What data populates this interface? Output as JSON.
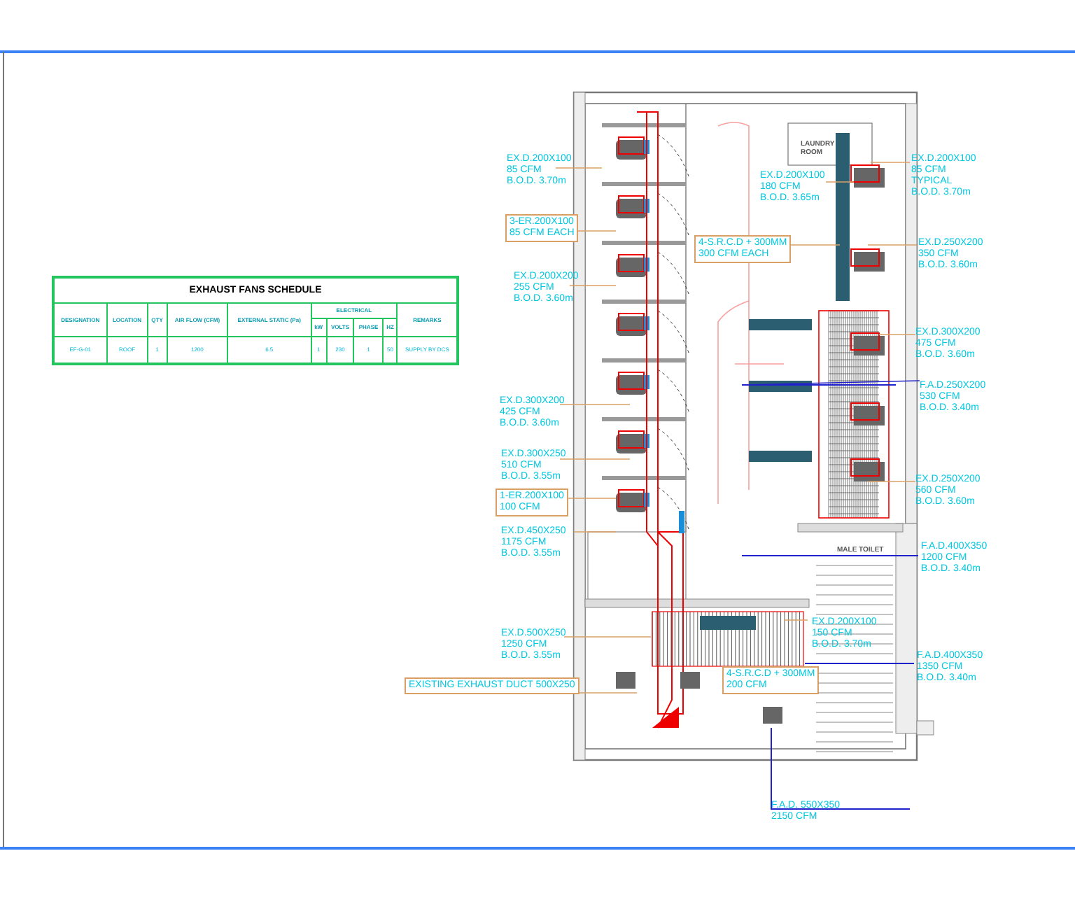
{
  "schedule": {
    "title": "EXHAUST FANS SCHEDULE",
    "group_header": "ELECTRICAL",
    "columns": [
      {
        "label": "DESIGNATION",
        "grouped": false
      },
      {
        "label": "LOCATION",
        "grouped": false
      },
      {
        "label": "QTY",
        "grouped": false
      },
      {
        "label": "AIR FLOW (CFM)",
        "grouped": false
      },
      {
        "label": "EXTERNAL STATIC (Pa)",
        "grouped": false
      },
      {
        "label": "kW",
        "grouped": true
      },
      {
        "label": "VOLTS",
        "grouped": true
      },
      {
        "label": "PHASE",
        "grouped": true
      },
      {
        "label": "HZ",
        "grouped": true
      },
      {
        "label": "REMARKS",
        "grouped": false
      }
    ],
    "rows": [
      [
        "EF-G-01",
        "ROOF",
        "1",
        "1200",
        "6.5",
        "1",
        "230",
        "1",
        "50",
        "SUPPLY BY DCS"
      ]
    ]
  },
  "plan": {
    "labels": [
      {
        "kind": "plain",
        "color": "#00c8e0",
        "lines": [
          "EX.D.200X100",
          "85 CFM",
          "B.O.D. 3.70m"
        ]
      },
      {
        "kind": "boxed",
        "color": "#00c8e0",
        "lines": [
          "3-ER.200X100",
          "85 CFM EACH"
        ]
      },
      {
        "kind": "plain",
        "color": "#00c8e0",
        "lines": [
          "EX.D.200X200",
          "255 CFM",
          "B.O.D. 3.60m"
        ]
      },
      {
        "kind": "plain",
        "color": "#00c8e0",
        "lines": [
          "EX.D.300X200",
          "425 CFM",
          "B.O.D. 3.60m"
        ]
      },
      {
        "kind": "plain",
        "color": "#00c8e0",
        "lines": [
          "EX.D.300X250",
          "510 CFM",
          "B.O.D. 3.55m"
        ]
      },
      {
        "kind": "boxed",
        "color": "#00c8e0",
        "lines": [
          "1-ER.200X100",
          "100 CFM"
        ]
      },
      {
        "kind": "plain",
        "color": "#00c8e0",
        "lines": [
          "EX.D.450X250",
          "1175 CFM",
          "B.O.D. 3.55m"
        ]
      },
      {
        "kind": "plain",
        "color": "#00c8e0",
        "lines": [
          "EX.D.500X250",
          "1250 CFM",
          "B.O.D. 3.55m"
        ]
      },
      {
        "kind": "boxed",
        "color": "#00c8e0",
        "lines": [
          "EXISTING EXHAUST DUCT 500X250"
        ]
      },
      {
        "kind": "boxed",
        "color": "#00c8e0",
        "lines": [
          "4-S.R.C.D + 300MM",
          "300 CFM EACH"
        ]
      },
      {
        "kind": "room",
        "color": "#555555",
        "lines": [
          "LAUNDRY",
          "ROOM"
        ]
      },
      {
        "kind": "plain",
        "color": "#00c8e0",
        "lines": [
          "EX.D.200X100",
          "180 CFM",
          "B.O.D. 3.65m"
        ]
      },
      {
        "kind": "room",
        "color": "#555555",
        "lines": [
          "MALE TOILET"
        ]
      },
      {
        "kind": "plain",
        "color": "#00c8e0",
        "lines": [
          "EX.D.200X100",
          "150 CFM",
          "B.O.D. 3.70m"
        ]
      },
      {
        "kind": "boxed",
        "color": "#00c8e0",
        "lines": [
          "4-S.R.C.D + 300MM",
          "200 CFM"
        ]
      },
      {
        "kind": "plain",
        "color": "#00c8e0",
        "lines": [
          "EX.D.200X100",
          "85 CFM",
          "TYPICAL",
          "B.O.D. 3.70m"
        ]
      },
      {
        "kind": "plain",
        "color": "#00c8e0",
        "lines": [
          "EX.D.250X200",
          "350 CFM",
          "B.O.D. 3.60m"
        ]
      },
      {
        "kind": "plain",
        "color": "#00c8e0",
        "lines": [
          "EX.D.300X200",
          "475 CFM",
          "B.O.D. 3.60m"
        ]
      },
      {
        "kind": "plain",
        "color": "#00c8e0",
        "lines": [
          "F.A.D.250X200",
          "530 CFM",
          "B.O.D. 3.40m"
        ]
      },
      {
        "kind": "plain",
        "color": "#00c8e0",
        "lines": [
          "EX.D.250X200",
          "560 CFM",
          "B.O.D. 3.60m"
        ]
      },
      {
        "kind": "plain",
        "color": "#00c8e0",
        "lines": [
          "F.A.D.400X350",
          "1200 CFM",
          "B.O.D. 3.40m"
        ]
      },
      {
        "kind": "plain",
        "color": "#00c8e0",
        "lines": [
          "F.A.D.400X350",
          "1350 CFM",
          "B.O.D. 3.40m"
        ]
      },
      {
        "kind": "plain",
        "color": "#00c8e0",
        "lines": [
          "F.A.D. 550X350",
          "2150 CFM"
        ]
      }
    ]
  }
}
